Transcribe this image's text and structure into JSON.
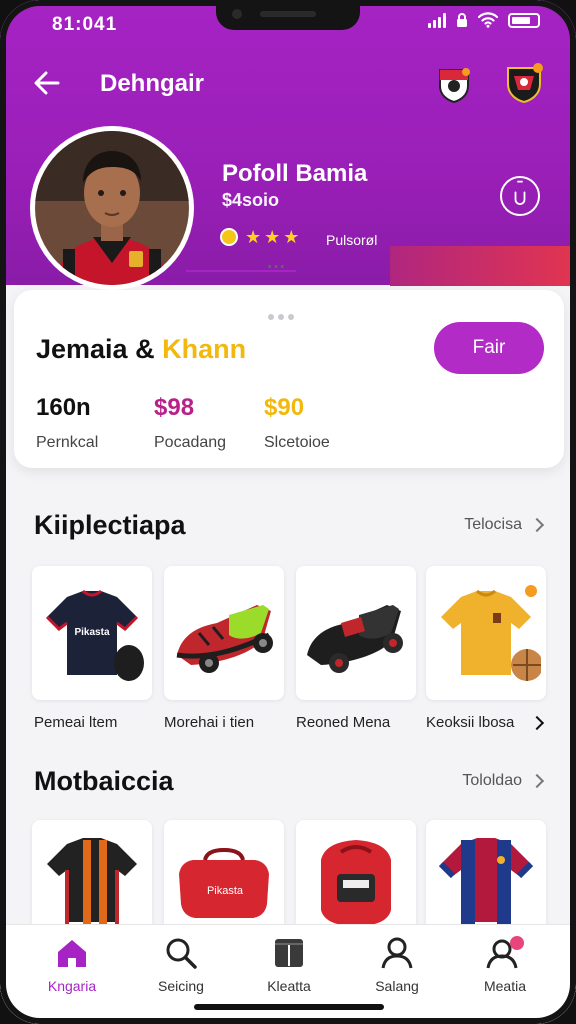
{
  "status": {
    "time": "81:041"
  },
  "nav": {
    "title": "Dehngair"
  },
  "profile": {
    "name": "Pofoll Bamia",
    "price": "$4soio",
    "rating_label": "Pulsorøl"
  },
  "team": {
    "name_part1": "Jemaia &",
    "name_part2": "Khann",
    "follow_label": "Fair"
  },
  "stats": [
    {
      "value": "160n",
      "label": "Pernkcal",
      "color": "#111111"
    },
    {
      "value": "$98",
      "label": "Pocadang",
      "color": "#b8208a"
    },
    {
      "value": "$90",
      "label": "Slcetoioe",
      "color": "#f2b90c"
    }
  ],
  "sections": [
    {
      "title": "Kiiplectiapa",
      "see_all": "Telocisa",
      "items": [
        {
          "caption": "Pemeai ltem",
          "icon": "jersey-navy-icon"
        },
        {
          "caption": "Morehai i tien",
          "icon": "sneaker-green-icon"
        },
        {
          "caption": "Reoned Mena",
          "icon": "sneaker-black-icon"
        },
        {
          "caption": "Keoksii lbosa",
          "icon": "jersey-yellow-icon"
        }
      ]
    },
    {
      "title": "Motbaiccia",
      "see_all": "Tololdao",
      "items": [
        {
          "caption": "",
          "icon": "jersey-striped-icon"
        },
        {
          "caption": "",
          "icon": "bag-red-icon"
        },
        {
          "caption": "",
          "icon": "backpack-red-icon"
        },
        {
          "caption": "",
          "icon": "jersey-barca-icon"
        }
      ]
    }
  ],
  "tabbar": [
    {
      "label": "Kngaria",
      "icon": "home-icon",
      "active": true
    },
    {
      "label": "Seicing",
      "icon": "search-icon",
      "active": false
    },
    {
      "label": "Kleatta",
      "icon": "book-icon",
      "active": false
    },
    {
      "label": "Salang",
      "icon": "user-icon",
      "active": false
    },
    {
      "label": "Meatia",
      "icon": "profile-notification-icon",
      "active": false
    }
  ],
  "colors": {
    "header": "#a623c4",
    "accent": "#b22bc6",
    "gold": "#f2b90c",
    "price": "#b8208a"
  }
}
